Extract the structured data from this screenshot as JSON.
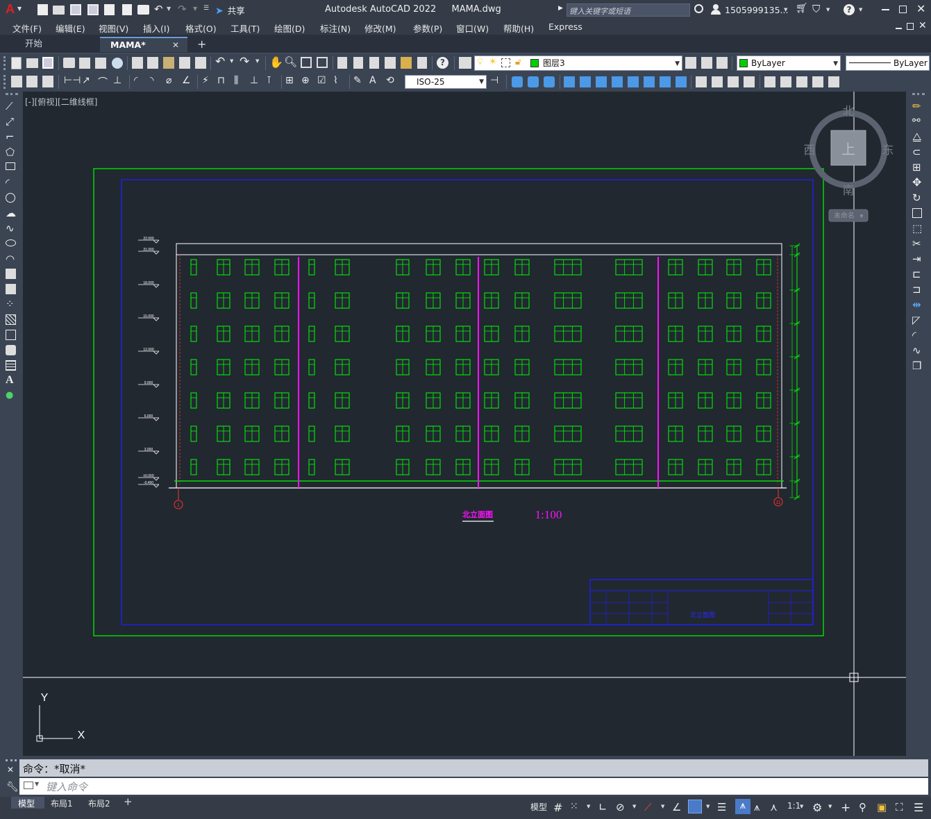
{
  "window": {
    "app_title": "Autodesk AutoCAD 2022",
    "doc_title": "MAMA.dwg",
    "search_placeholder": "键入关键字或短语",
    "user": "1505999135...",
    "share_label": "共享"
  },
  "menu": [
    "文件(F)",
    "编辑(E)",
    "视图(V)",
    "插入(I)",
    "格式(O)",
    "工具(T)",
    "绘图(D)",
    "标注(N)",
    "修改(M)",
    "参数(P)",
    "窗口(W)",
    "帮助(H)",
    "Express"
  ],
  "tabs": [
    {
      "label": "开始",
      "active": false
    },
    {
      "label": "MAMA*",
      "active": true
    }
  ],
  "toolbar": {
    "layer_name": "图层3",
    "color_value": "ByLayer",
    "linetype_value": "ByLayer",
    "dimstyle_value": "ISO-25"
  },
  "viewport": {
    "view_label": "[-][俯视][二维线框]",
    "viewcube_top": "上",
    "compass_north": "北",
    "compass_south": "南",
    "compass_east": "东",
    "compass_west": "西",
    "ucs_name": "未命名",
    "ucs_x": "X",
    "ucs_y": "Y"
  },
  "drawing": {
    "title": "北立面图",
    "scale": "1:100",
    "titleblock_name": "北立面图",
    "axis_left": "1",
    "axis_right": "11",
    "elevation_marks": [
      "22.000",
      "21.000",
      "18.000",
      "15.000",
      "12.000",
      "9.000",
      "6.000",
      "3.000",
      "±0.000",
      "-0.450"
    ]
  },
  "command": {
    "history": "命令：*取消*",
    "placeholder": "键入命令"
  },
  "layout_tabs": [
    "模型",
    "布局1",
    "布局2"
  ],
  "status": {
    "model_label": "模型",
    "scale_label": "1:1"
  },
  "colors": {
    "canvas_bg": "#212830",
    "chrome_bg": "#3b4453",
    "green_line": "#00e000",
    "blue_line": "#1a1ad8",
    "magenta": "#ff10ff",
    "window_green": "#00ff00",
    "axis_red": "#ff2020"
  }
}
